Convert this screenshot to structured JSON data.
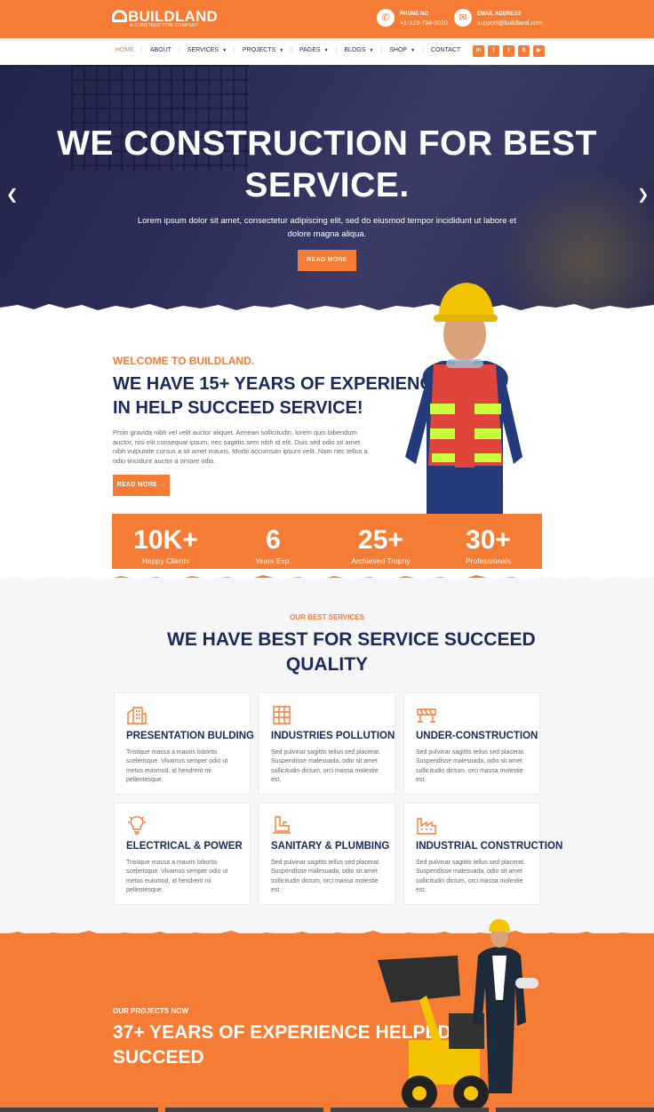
{
  "brand": {
    "name": "BUILDLAND",
    "tagline": "A CONSTRUCTION COMPANY"
  },
  "topbar": {
    "phone": {
      "label": "PHONE NO",
      "value": "+1-123-754-3010",
      "icon": "phone-icon"
    },
    "email": {
      "label": "EMAIL ADDRESS",
      "value": "support@buildland.com",
      "icon": "envelope-icon"
    }
  },
  "nav": {
    "items": [
      {
        "label": "HOME",
        "active": true,
        "dropdown": false
      },
      {
        "label": "ABOUT",
        "active": false,
        "dropdown": false
      },
      {
        "label": "SERVICES",
        "active": false,
        "dropdown": true
      },
      {
        "label": "PROJECTS",
        "active": false,
        "dropdown": true
      },
      {
        "label": "PAGES",
        "active": false,
        "dropdown": true
      },
      {
        "label": "BLOGS",
        "active": false,
        "dropdown": true
      },
      {
        "label": "SHOP",
        "active": false,
        "dropdown": true
      },
      {
        "label": "CONTACT",
        "active": false,
        "dropdown": false
      }
    ],
    "socials": [
      "linkedin-icon",
      "facebook-icon",
      "twitter-icon",
      "skype-icon",
      "youtube-icon"
    ]
  },
  "hero": {
    "title_line1": "WE CONSTRUCTION FOR BEST",
    "title_line2": "SERVICE.",
    "text": "Lorem ipsum dolor sit amet, consectetur adipiscing elit, sed do eiusmod tempor incididunt ut labore et dolore magna aliqua.",
    "button": "READ MORE"
  },
  "about": {
    "tag": "WELCOME TO BUILDLAND.",
    "title_line1": "WE HAVE 15+ YEARS OF EXPERIENCE",
    "title_line2": "IN HELP SUCCEED SERVICE!",
    "text": "Proin gravida nibh vel velit auctor aliquet. Aenean sollicitudin, lorem quis bibendum auctor, nisi elit consequat ipsum, nec sagittis sem nibh id elit. Duis sed odio sit amet nibh vulputate cursus a sit amet mauris. Morbi accumsan ipsum velit. Nam nec tellus a odio tincidunt auctor a ornare odio.",
    "button": "READ MORE"
  },
  "stats": [
    {
      "value": "10K+",
      "label": "Happy Clients"
    },
    {
      "value": "6",
      "label": "Years Exp."
    },
    {
      "value": "25+",
      "label": "Archieved Trophy"
    },
    {
      "value": "30+",
      "label": "Professionals"
    }
  ],
  "services": {
    "tag": "OUR BEST SERVICES",
    "title_line1": "WE HAVE BEST FOR SERVICE SUCCEED",
    "title_line2": "QUALITY",
    "cards": [
      {
        "icon": "building-icon",
        "title": "PRESENTATION BULDING",
        "text": "Tristique massa a mauris lobortis scelerisque. Vivamus semper odio ut metus euismod, id hendrerit mi pellentesque."
      },
      {
        "icon": "factory-icon",
        "title": "INDUSTRIES POLLUTION",
        "text": "Sed pulvinar sagittis tellus sed placerat. Suspendisse malesuada, odio sit amet sollicitudin dictum, orci massa molestie est."
      },
      {
        "icon": "barrier-icon",
        "title": "UNDER-CONSTRUCTION",
        "text": "Sed pulvinar sagittis tellus sed placerat. Suspendisse malesuada, odio sit amet sollicitudin dictum, orci massa molestie est."
      },
      {
        "icon": "lightbulb-icon",
        "title": "ELECTRICAL & POWER",
        "text": "Tristique massa a mauris lobortis scelerisque. Vivamus semper odio ut metus euismod, id hendrerit mi pellentesque."
      },
      {
        "icon": "pipe-icon",
        "title": "SANITARY & PLUMBING",
        "text": "Sed pulvinar sagittis tellus sed placerat. Suspendisse malesuada, odio sit amet sollicitudin dictum, orci massa molestie est."
      },
      {
        "icon": "industry-icon",
        "title": "INDUSTRIAL CONSTRUCTION",
        "text": "Sed pulvinar sagittis tellus sed placerat. Suspendisse malesuada, odio sit amet sollicitudin dictum, orci massa molestie est."
      }
    ]
  },
  "projects": {
    "tag": "OUR PROJECTS NOW",
    "title_line1": "37+ YEARS OF EXPERIENCE HELPED",
    "title_line2": "SUCCEED"
  },
  "colors": {
    "accent": "#f57c35",
    "navy": "#1b2a5b"
  }
}
